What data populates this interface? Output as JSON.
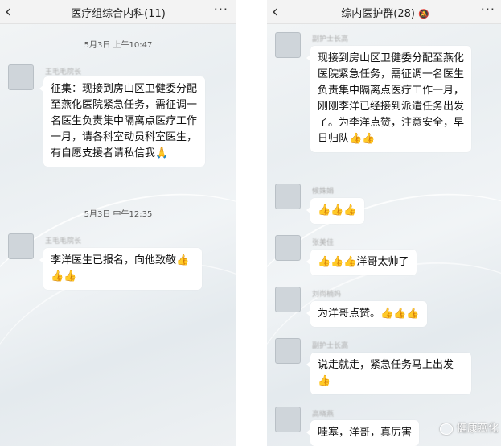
{
  "left": {
    "title": "医疗组综合内科(11)",
    "back_icon": "chevron-left-icon",
    "more_icon": "more-horizontal-icon",
    "timestamps": [
      "5月3日 上午10:47",
      "5月3日 中午12:35"
    ],
    "messages": [
      {
        "sender": "王毛毛院长",
        "text": "征集：现接到房山区卫健委分配至燕化医院紧急任务，需征调一名医生负责集中隔离点医疗工作一月，请各科室动员科室医生，有自愿支援者请私信我🙏"
      },
      {
        "sender": "王毛毛院长",
        "text": "李洋医生已报名，向他致敬👍👍👍"
      }
    ]
  },
  "right": {
    "title": "综内医护群(28)",
    "mute_icon": "mute-icon",
    "messages": [
      {
        "sender": "副护士长高",
        "text": "现接到房山区卫健委分配至燕化医院紧急任务，需征调一名医生负责集中隔离点医疗工作一月，刚刚李洋已经接到派遣任务出发了。为李洋点赞，注意安全，早日归队👍👍"
      },
      {
        "sender": "候姝娟",
        "text": "👍👍👍"
      },
      {
        "sender": "张美佳",
        "text": "👍👍👍洋哥太帅了"
      },
      {
        "sender": "刘尚楠妈",
        "text": "为洋哥点赞。👍👍👍"
      },
      {
        "sender": "副护士长高",
        "text": "说走就走，紧急任务马上出发👍"
      },
      {
        "sender": "高晓燕",
        "text": "哇塞，洋哥，真厉害"
      }
    ]
  },
  "watermark": {
    "text": "健康燕化",
    "icon": "wechat-official-account-icon"
  }
}
